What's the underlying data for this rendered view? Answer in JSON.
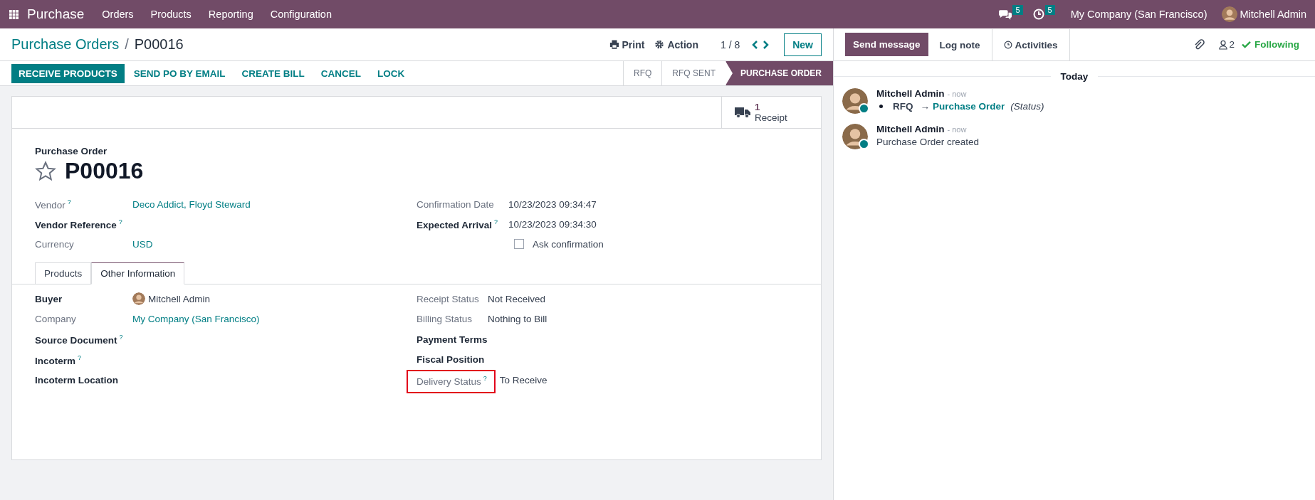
{
  "navbar": {
    "app": "Purchase",
    "menus": [
      "Orders",
      "Products",
      "Reporting",
      "Configuration"
    ],
    "messages_badge": "5",
    "activities_badge": "5",
    "company": "My Company (San Francisco)",
    "user": "Mitchell Admin"
  },
  "breadcrumb": {
    "parent": "Purchase Orders",
    "separator": "/",
    "current": "P00016",
    "print": "Print",
    "action": "Action",
    "pager": "1 / 8",
    "new": "New"
  },
  "actions": [
    {
      "label": "RECEIVE PRODUCTS",
      "primary": true
    },
    {
      "label": "SEND PO BY EMAIL",
      "primary": false
    },
    {
      "label": "CREATE BILL",
      "primary": false
    },
    {
      "label": "CANCEL",
      "primary": false
    },
    {
      "label": "LOCK",
      "primary": false
    }
  ],
  "status_steps": [
    {
      "label": "RFQ",
      "selected": false
    },
    {
      "label": "RFQ SENT",
      "selected": false
    },
    {
      "label": "PURCHASE ORDER",
      "selected": true
    }
  ],
  "smart_button": {
    "count": "1",
    "label": "Receipt"
  },
  "form": {
    "kind_label": "Purchase Order",
    "name": "P00016",
    "favorite": false,
    "left_fields": [
      {
        "label": "Vendor",
        "required": false,
        "help": "?",
        "value": "Deco Addict, Floyd Steward",
        "kind": "link"
      },
      {
        "label": "Vendor Reference",
        "required": true,
        "help": "?",
        "kind": "empty"
      },
      {
        "label": "Currency",
        "required": false,
        "kind": "link",
        "value": "USD"
      }
    ],
    "right_fields": [
      {
        "label": "Confirmation Date",
        "required": false,
        "kind": "text",
        "value": "10/23/2023 09:34:47"
      },
      {
        "label": "Expected Arrival",
        "required": true,
        "help": "?",
        "kind": "text",
        "value": "10/23/2023 09:34:30"
      },
      {
        "label": "Ask confirmation",
        "kind": "checkbox",
        "checked": false
      }
    ]
  },
  "tabs": [
    {
      "label": "Products",
      "selected": false
    },
    {
      "label": "Other Information",
      "selected": true
    }
  ],
  "other_info": {
    "left_fields": [
      {
        "label": "Buyer",
        "required": true,
        "kind": "avatar",
        "value": "Mitchell Admin",
        "highlighted": false
      },
      {
        "label": "Company",
        "required": false,
        "kind": "link",
        "value": "My Company (San Francisco)",
        "highlighted": false
      },
      {
        "label": "Source Document",
        "required": true,
        "help": "?",
        "kind": "empty",
        "highlighted": false
      },
      {
        "label": "Incoterm",
        "required": true,
        "help": "?",
        "kind": "empty",
        "highlighted": false
      },
      {
        "label": "Incoterm Location",
        "required": true,
        "kind": "empty",
        "highlighted": false
      }
    ],
    "right_fields": [
      {
        "label": "Receipt Status",
        "required": false,
        "kind": "text",
        "value": "Not Received",
        "highlighted": false
      },
      {
        "label": "Billing Status",
        "required": false,
        "kind": "text",
        "value": "Nothing to Bill",
        "highlighted": false
      },
      {
        "label": "Payment Terms",
        "required": true,
        "kind": "empty",
        "highlighted": false
      },
      {
        "label": "Fiscal Position",
        "required": true,
        "kind": "empty",
        "highlighted": false
      },
      {
        "label": "Delivery Status",
        "required": false,
        "help": "?",
        "kind": "text",
        "value": "To Receive",
        "highlighted": true
      }
    ]
  },
  "chatter": {
    "send_message": "Send message",
    "log_note": "Log note",
    "activities": "Activities",
    "followers": "2",
    "following": "Following",
    "day": "Today",
    "messages": [
      {
        "author": "Mitchell Admin",
        "time": "- now",
        "kind": "tracking",
        "old": "RFQ",
        "arrow": "→",
        "new": "Purchase Order",
        "field": "(Status)"
      },
      {
        "author": "Mitchell Admin",
        "time": "- now",
        "kind": "text",
        "body": "Purchase Order created"
      }
    ]
  }
}
